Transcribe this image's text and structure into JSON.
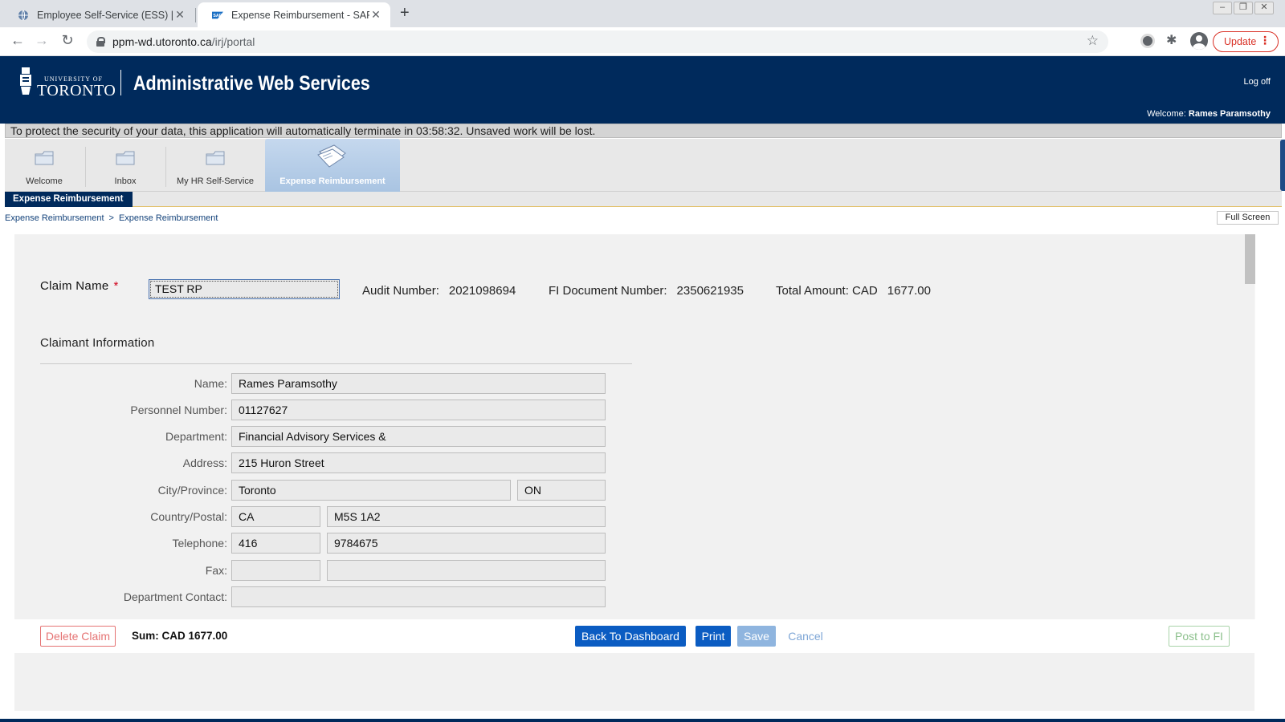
{
  "browser": {
    "tabs": [
      {
        "title": "Employee Self-Service (ESS) | EAS"
      },
      {
        "title": "Expense Reimbursement - SAP N"
      }
    ],
    "url_host": "ppm-wd.utoronto.ca",
    "url_path": "/irj/portal",
    "update_label": "Update"
  },
  "header": {
    "university_small": "UNIVERSITY OF",
    "university_big": "TORONTO",
    "app_title": "Administrative Web Services",
    "logoff": "Log off",
    "welcome_label": "Welcome:",
    "welcome_user": "Rames Paramsothy"
  },
  "timeout_message": "To protect the security of your data, this application will automatically terminate in 03:58:32. Unsaved work will be lost.",
  "portal_tabs": [
    {
      "label": "Welcome"
    },
    {
      "label": "Inbox"
    },
    {
      "label": "My HR Self-Service"
    },
    {
      "label": "Expense Reimbursement"
    }
  ],
  "subnav": {
    "label": "Expense Reimbursement"
  },
  "breadcrumbs": [
    "Expense Reimbursement",
    ">",
    "Expense Reimbursement"
  ],
  "full_screen": "Full Screen",
  "claim": {
    "label": "Claim Name",
    "required_mark": "*",
    "value": "TEST RP",
    "audit_label": "Audit Number:",
    "audit_value": "2021098694",
    "fi_doc_label": "FI Document Number:",
    "fi_doc_value": "2350621935",
    "total_label": "Total Amount: CAD",
    "total_value": "1677.00"
  },
  "claimant": {
    "section_title": "Claimant Information",
    "name_label": "Name:",
    "name": "Rames Paramsothy",
    "personnel_label": "Personnel Number:",
    "personnel": "01127627",
    "department_label": "Department:",
    "department": "Financial Advisory Services &",
    "address_label": "Address:",
    "address": "215 Huron Street",
    "city_label": "City/Province:",
    "city": "Toronto",
    "province": "ON",
    "country_label": "Country/Postal:",
    "country": "CA",
    "postal": "M5S 1A2",
    "telephone_label": "Telephone:",
    "area_code": "416",
    "phone": "9784675",
    "fax_label": "Fax:",
    "fax_area": "",
    "fax": "",
    "contact_label": "Department Contact:",
    "contact": ""
  },
  "actions": {
    "delete": "Delete Claim",
    "sum": "Sum: CAD  1677.00",
    "back": "Back To Dashboard",
    "print": "Print",
    "save": "Save",
    "cancel": "Cancel",
    "post": "Post to FI"
  },
  "colors": {
    "brand_navy": "#002a5c",
    "primary_button": "#0b5cc2",
    "delete_red": "#e57373",
    "post_green": "#8cc08c"
  }
}
